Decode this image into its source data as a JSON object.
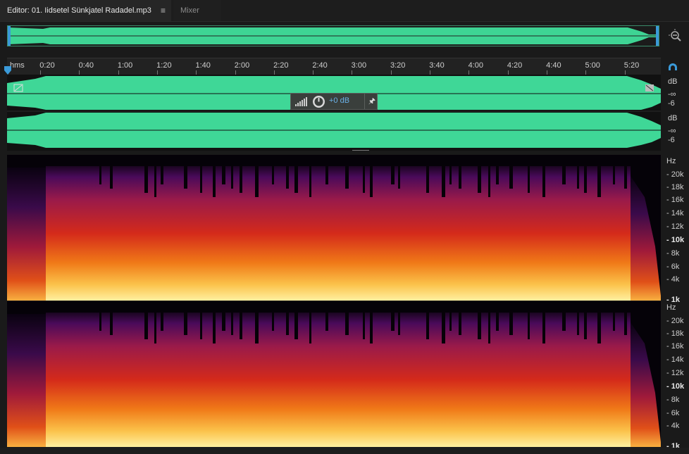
{
  "tabs": {
    "editor_label": "Editor: 01. Iidsetel Sünkjatel Radadel.mp3",
    "menu_glyph": "≡",
    "mixer_label": "Mixer"
  },
  "ruler": {
    "unit": "hms",
    "ticks": [
      "0:20",
      "0:40",
      "1:00",
      "1:20",
      "1:40",
      "2:00",
      "2:20",
      "2:40",
      "3:00",
      "3:20",
      "3:40",
      "4:00",
      "4:20",
      "4:40",
      "5:00",
      "5:20"
    ]
  },
  "hud": {
    "volume": "+0 dB"
  },
  "db_scale": {
    "label": "dB",
    "neg_inf": "-∞",
    "minus6": "-6"
  },
  "hz_scale": {
    "label": "Hz",
    "ticks": [
      "20k",
      "18k",
      "16k",
      "14k",
      "12k",
      "10k",
      "8k",
      "6k",
      "4k",
      "1k"
    ]
  },
  "colors": {
    "waveform": "#3fd797",
    "overview": "#3ed494",
    "accent": "#3a9ad9"
  },
  "icons": {
    "zoom": "zoom-magnifier-icon",
    "snap": "snap-magnet-icon",
    "pin": "pin-icon"
  }
}
